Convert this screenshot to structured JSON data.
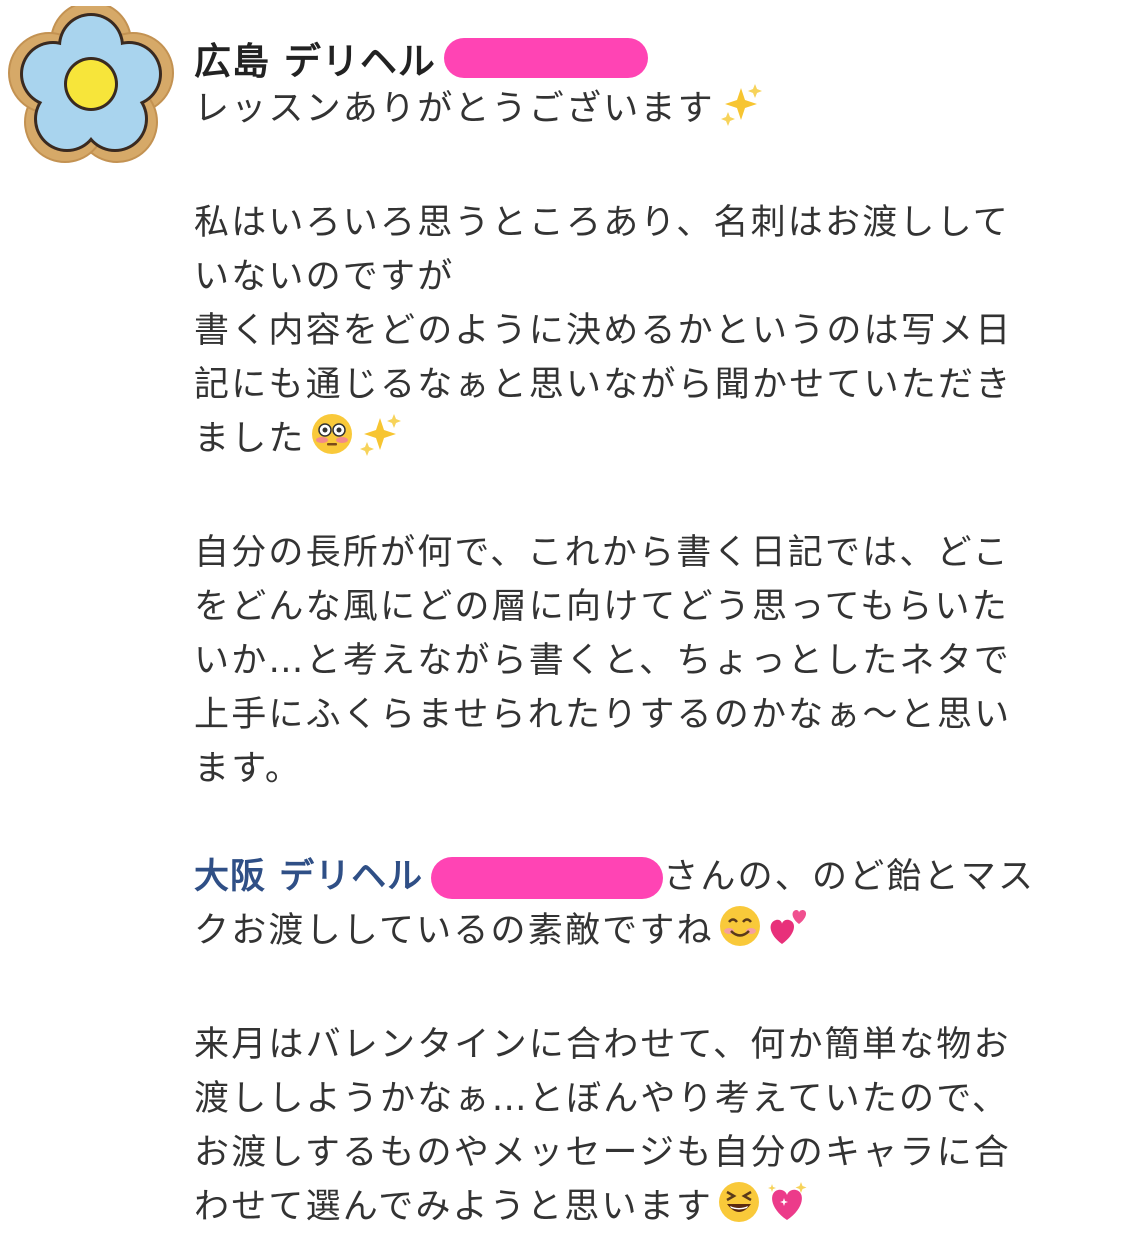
{
  "post": {
    "author": "広島 デリヘル",
    "paragraphs": {
      "p1": "レッスンありがとうございます",
      "p2_l1": "私はいろいろ思うところあり、名刺はお渡しして",
      "p2_l2": "いないのですが",
      "p2_l3": "書く内容をどのように決めるかというのは写メ日",
      "p2_l4": "記にも通じるなぁと思いながら聞かせていただき",
      "p2_l5": "ました",
      "p3_l1": "自分の長所が何で、これから書く日記では、どこ",
      "p3_l2": "をどんな風にどの層に向けてどう思ってもらいた",
      "p3_l3": "いか…と考えながら書くと、ちょっとしたネタで",
      "p3_l4": "上手にふくらませられたりするのかなぁ〜と思い",
      "p3_l5": "ます。",
      "p4_mention": "大阪 デリヘル",
      "p4_l1_rest": "さんの、のど飴とマス",
      "p4_l2": "クお渡ししているの素敵ですね",
      "p5_l1": "来月はバレンタインに合わせて、何か簡単な物お",
      "p5_l2": "渡ししようかなぁ…とぼんやり考えていたので、",
      "p5_l3": "お渡しするものやメッセージも自分のキャラに合",
      "p5_l4": "わせて選んでみようと思います"
    }
  },
  "icons": [
    "flower-avatar-icon",
    "sparkles-icon",
    "flushed-face-icon",
    "smiling-face-icon",
    "two-hearts-icon",
    "grinning-squinting-face-icon",
    "sparkling-heart-icon"
  ],
  "colors": {
    "redaction": "#ff44b4",
    "mention": "#2f4f86",
    "text": "#333333"
  }
}
